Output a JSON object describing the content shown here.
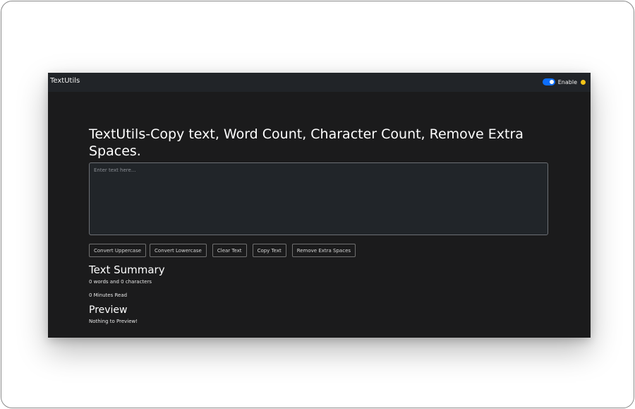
{
  "navbar": {
    "brand": "TextUtils",
    "toggle_label": "Enable",
    "toggle_on": true,
    "emoji_color": "#f5c518",
    "switch_color": "#0d6efd"
  },
  "main": {
    "heading": "TextUtils-Copy text, Word Count, Character Count, Remove Extra Spaces.",
    "textarea": {
      "value": "",
      "placeholder": "Enter text here..."
    },
    "buttons": [
      {
        "label": "Convert Uppercase"
      },
      {
        "label": "Convert Lowercase"
      },
      {
        "label": "Clear Text"
      },
      {
        "label": "Copy Text"
      },
      {
        "label": "Remove Extra Spaces"
      }
    ]
  },
  "summary": {
    "heading": "Text Summary",
    "counts": "0 words and 0 characters",
    "read_time": "0 Minutes Read"
  },
  "preview": {
    "heading": "Preview",
    "text": "Nothing to Preview!"
  },
  "colors": {
    "background": "#1b1b1c",
    "navbar": "#212428"
  }
}
